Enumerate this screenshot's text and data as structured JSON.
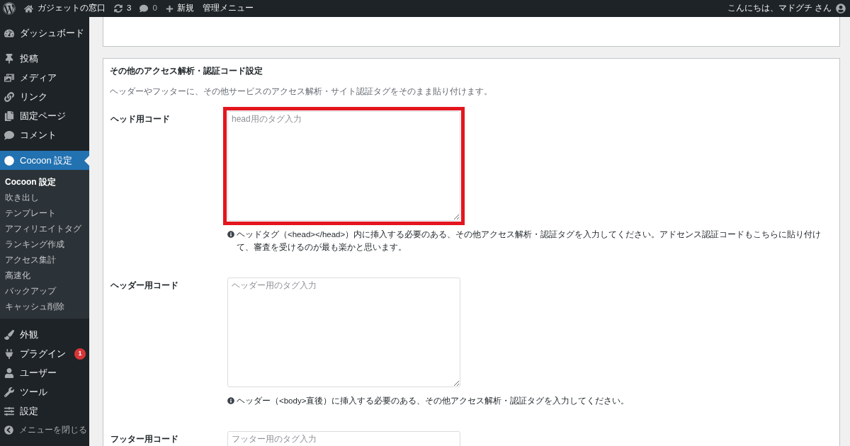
{
  "admin_bar": {
    "site_name": "ガジェットの窓口",
    "updates": "3",
    "comments": "0",
    "new_label": "新規",
    "admin_menu": "管理メニュー",
    "greeting": "こんにちは、マドグチ さん"
  },
  "sidebar": {
    "items": [
      {
        "label": "ダッシュボード",
        "selected": false
      },
      {
        "label": "投稿",
        "selected": false
      },
      {
        "label": "メディア",
        "selected": false
      },
      {
        "label": "リンク",
        "selected": false
      },
      {
        "label": "固定ページ",
        "selected": false
      },
      {
        "label": "コメント",
        "selected": false
      },
      {
        "label": "Cocoon 設定",
        "selected": true,
        "children": [
          {
            "label": "Cocoon 設定",
            "selected": true
          },
          {
            "label": "吹き出し",
            "selected": false
          },
          {
            "label": "テンプレート",
            "selected": false
          },
          {
            "label": "アフィリエイトタグ",
            "selected": false
          },
          {
            "label": "ランキング作成",
            "selected": false
          },
          {
            "label": "アクセス集計",
            "selected": false
          },
          {
            "label": "高速化",
            "selected": false
          },
          {
            "label": "バックアップ",
            "selected": false
          },
          {
            "label": "キャッシュ削除",
            "selected": false
          }
        ]
      },
      {
        "label": "外観",
        "selected": false
      },
      {
        "label": "プラグイン",
        "selected": false,
        "badge": "1"
      },
      {
        "label": "ユーザー",
        "selected": false
      },
      {
        "label": "ツール",
        "selected": false
      },
      {
        "label": "設定",
        "selected": false
      }
    ],
    "collapse": "メニューを閉じる"
  },
  "section": {
    "title": "その他のアクセス解析・認証コード設定",
    "description": "ヘッダーやフッターに、その他サービスのアクセス解析・サイト認証タグをそのまま貼り付けます。",
    "fields": [
      {
        "label": "ヘッド用コード",
        "placeholder": "head用のタグ入力",
        "highlighted": true,
        "help": "ヘッドタグ（<head></head>）内に挿入する必要のある、その他アクセス解析・認証タグを入力してください。アドセンス認証コードもこちらに貼り付けて、審査を受けるのが最も楽かと思います。"
      },
      {
        "label": "ヘッダー用コード",
        "placeholder": "ヘッダー用のタグ入力",
        "highlighted": false,
        "help": "ヘッダー（<body>直後）に挿入する必要のある、その他アクセス解析・認証タグを入力してください。"
      },
      {
        "label": "フッター用コード",
        "placeholder": "フッター用のタグ入力",
        "highlighted": false
      }
    ]
  }
}
